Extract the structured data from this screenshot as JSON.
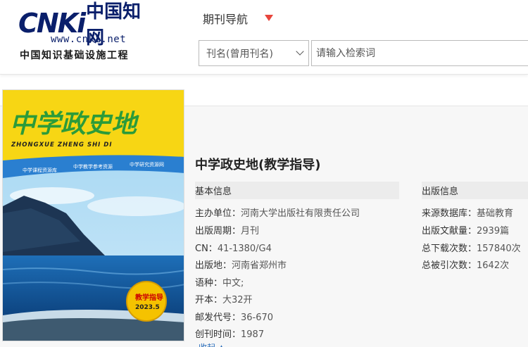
{
  "logo": {
    "letters": "CNKi",
    "cn_name": "中国知网",
    "url": "www.cnki.net",
    "subtitle": "中国知识基础设施工程"
  },
  "nav": {
    "title": "期刊导航"
  },
  "search": {
    "field_value": "刊名(曾用刊名)",
    "placeholder": "请输入检索词"
  },
  "cover": {
    "title_cn": "中学政史地",
    "title_pinyin": "ZHONGXUE ZHENG SHI DI",
    "taglines": [
      "中学课程资源库",
      "中学教学参考资源",
      "中学研究资源网"
    ],
    "badge_title": "教学指导",
    "badge_issue": "2023.5"
  },
  "journal": {
    "title": "中学政史地(教学指导)"
  },
  "basic_info": {
    "heading": "基本信息",
    "rows": [
      {
        "label": "主办单位：",
        "value": "河南大学出版社有限责任公司"
      },
      {
        "label": "出版周期：",
        "value": "月刊"
      },
      {
        "label": "CN：",
        "value": "41-1380/G4"
      },
      {
        "label": "出版地：",
        "value": "河南省郑州市"
      },
      {
        "label": "语种：",
        "value": "中文;"
      },
      {
        "label": "开本：",
        "value": "大32开"
      },
      {
        "label": "邮发代号：",
        "value": "36-670"
      },
      {
        "label": "创刊时间：",
        "value": "1987"
      }
    ]
  },
  "pub_info": {
    "heading": "出版信息",
    "rows": [
      {
        "label": "来源数据库：",
        "value": "基础教育"
      },
      {
        "label": "出版文献量：",
        "value": "2939篇"
      },
      {
        "label": "总下载次数：",
        "value": "157840次"
      },
      {
        "label": "总被引次数：",
        "value": "1642次"
      }
    ]
  },
  "expand": {
    "label": "收起 ▲"
  },
  "colors": {
    "accent_red": "#e8453c",
    "logo_blue": "#0a1f6b",
    "link_blue": "#2a6ebb"
  }
}
